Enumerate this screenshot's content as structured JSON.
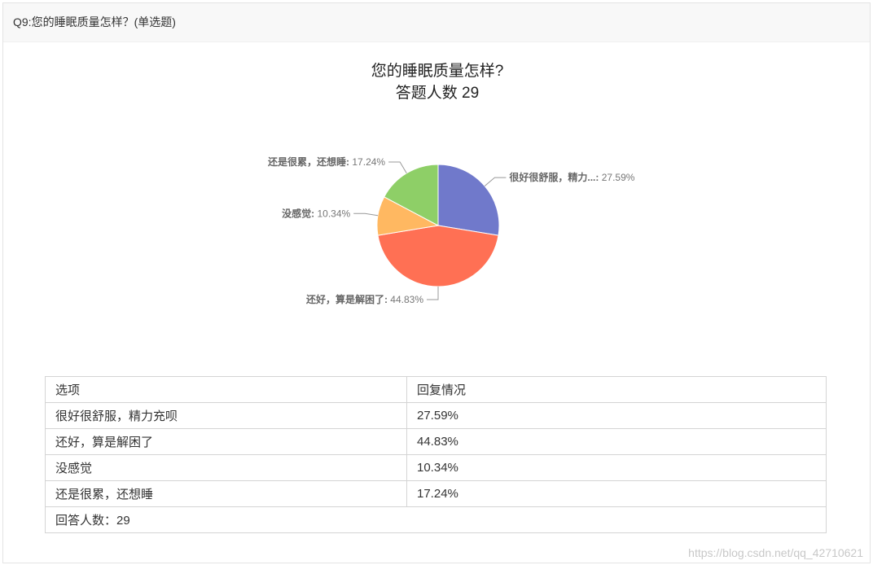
{
  "question": {
    "header": "Q9:您的睡眠质量怎样？(单选题)"
  },
  "chart_data": {
    "type": "pie",
    "title": "您的睡眠质量怎样?",
    "subtitle": "答题人数 29",
    "slices": [
      {
        "name": "很好很舒服，精力...",
        "full_name": "很好很舒服，精力充呗",
        "value": 27.59,
        "color": "#7079cb"
      },
      {
        "name": "还好，算是解困了",
        "full_name": "还好，算是解困了",
        "value": 44.83,
        "color": "#ff7054"
      },
      {
        "name": "没感觉",
        "full_name": "没感觉",
        "value": 10.34,
        "color": "#ffb861"
      },
      {
        "name": "还是很累，还想睡",
        "full_name": "还是很累，还想睡",
        "value": 17.24,
        "color": "#8ecf67"
      }
    ]
  },
  "table": {
    "header_option": "选项",
    "header_reply": "回复情况",
    "rows": [
      {
        "option": "很好很舒服，精力充呗",
        "percent": "27.59%"
      },
      {
        "option": "还好，算是解困了",
        "percent": "44.83%"
      },
      {
        "option": "没感觉",
        "percent": "10.34%"
      },
      {
        "option": "还是很累，还想睡",
        "percent": "17.24%"
      }
    ],
    "footer": "回答人数：29"
  },
  "watermark": "https://blog.csdn.net/qq_42710621"
}
